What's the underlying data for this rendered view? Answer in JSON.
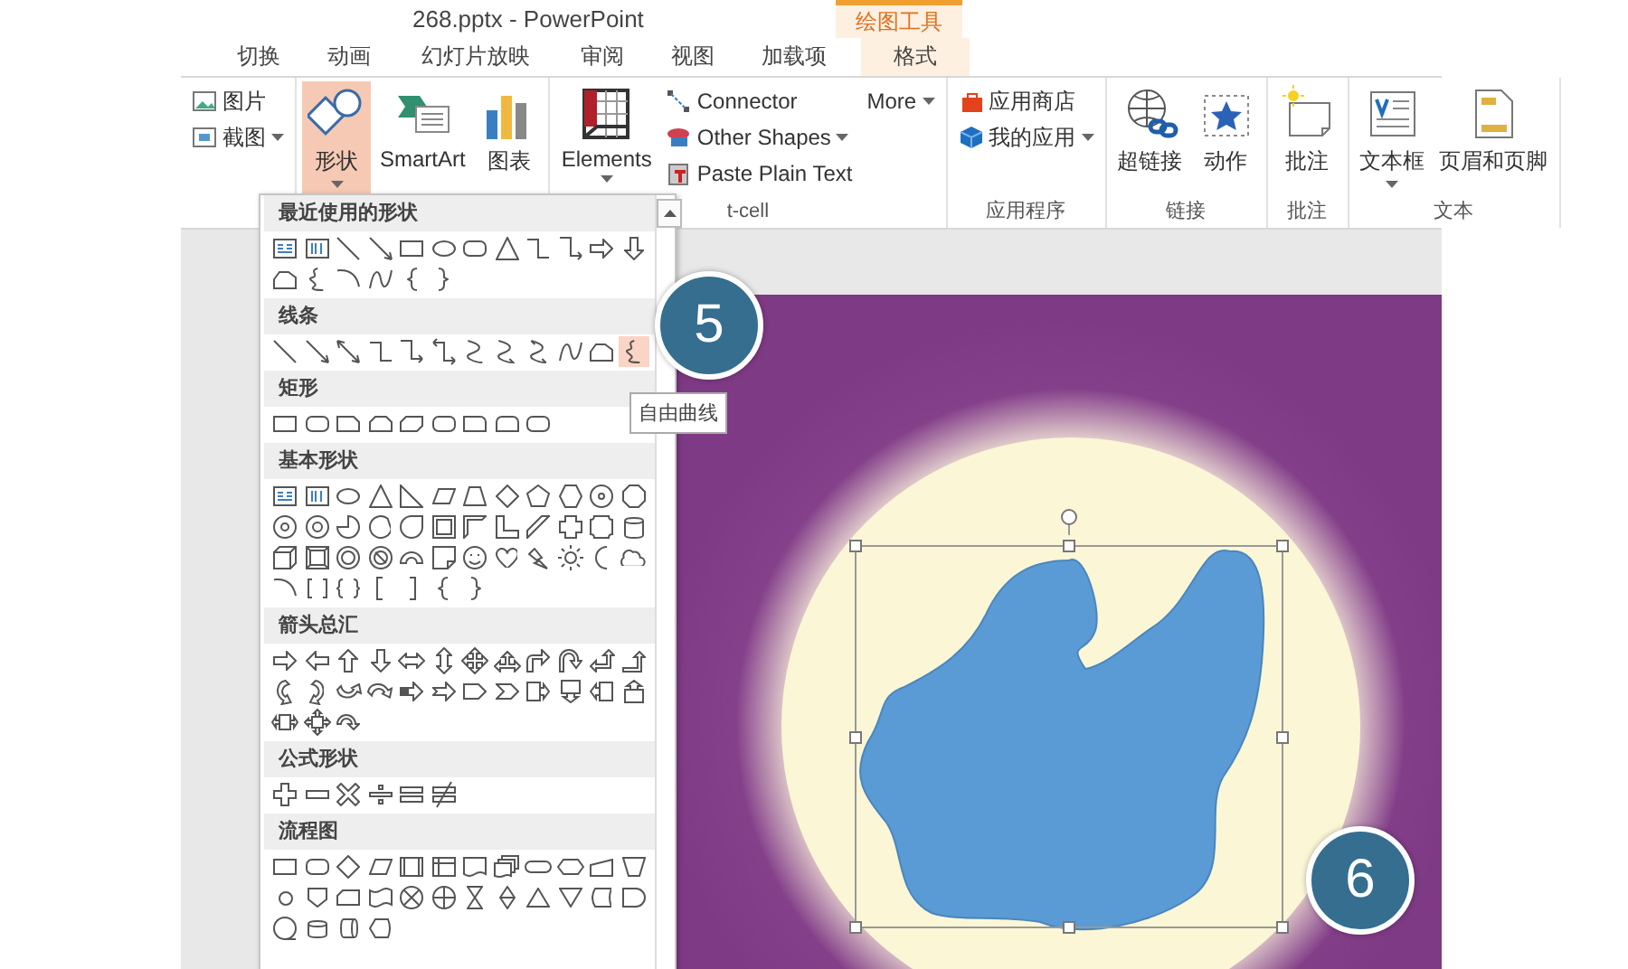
{
  "window": {
    "title": "268.pptx - PowerPoint",
    "context_tab": "绘图工具"
  },
  "tabs": [
    {
      "label": "切换",
      "selected": false
    },
    {
      "label": "动画",
      "selected": false
    },
    {
      "label": "幻灯片放映",
      "selected": false
    },
    {
      "label": "审阅",
      "selected": false
    },
    {
      "label": "视图",
      "selected": false
    },
    {
      "label": "加载项",
      "selected": false
    },
    {
      "label": "格式",
      "selected": true
    }
  ],
  "ribbon": {
    "groups": [
      {
        "columns": [
          {
            "kind": "small",
            "items": [
              {
                "kind": "picture",
                "label": "图片",
                "dropdown": false,
                "pressed": false
              },
              {
                "kind": "screenshot",
                "label": "截图",
                "dropdown": true,
                "pressed": false
              }
            ]
          }
        ]
      },
      {
        "columns": [
          {
            "kind": "large",
            "items": [
              {
                "kind": "shapes",
                "label": "形状",
                "dropdown": true,
                "pressed": true
              },
              {
                "kind": "smartart",
                "label": "SmartArt",
                "dropdown": false,
                "pressed": false
              },
              {
                "kind": "chart",
                "label": "图表",
                "dropdown": false,
                "pressed": false
              }
            ]
          }
        ]
      },
      {
        "label": "t-cell",
        "columns": [
          {
            "kind": "large",
            "items": [
              {
                "kind": "elements",
                "label": "Elements",
                "dropdown": true,
                "pressed": false
              }
            ]
          },
          {
            "kind": "small",
            "items": [
              {
                "kind": "connector",
                "label": "Connector",
                "dropdown": false,
                "pressed": false
              },
              {
                "kind": "other-shapes",
                "label": "Other Shapes",
                "dropdown": true,
                "pressed": false
              },
              {
                "kind": "paste",
                "label": "Paste Plain Text",
                "dropdown": false,
                "pressed": false
              }
            ]
          },
          {
            "kind": "small",
            "items": [
              {
                "kind": "none",
                "label": "More",
                "dropdown": true,
                "pressed": false
              }
            ]
          }
        ]
      },
      {
        "label": "应用程序",
        "columns": [
          {
            "kind": "small",
            "items": [
              {
                "kind": "store",
                "label": "应用商店",
                "dropdown": false,
                "pressed": false
              },
              {
                "kind": "myapps",
                "label": "我的应用",
                "dropdown": true,
                "pressed": false
              }
            ]
          }
        ]
      },
      {
        "label": "链接",
        "columns": [
          {
            "kind": "large",
            "items": [
              {
                "kind": "hyperlink",
                "label": "超链接",
                "dropdown": false,
                "pressed": false
              },
              {
                "kind": "action",
                "label": "动作",
                "dropdown": false,
                "pressed": false
              }
            ]
          }
        ]
      },
      {
        "label": "批注",
        "columns": [
          {
            "kind": "large",
            "items": [
              {
                "kind": "comment",
                "label": "批注",
                "dropdown": false,
                "pressed": false
              }
            ]
          }
        ]
      },
      {
        "label": "文本",
        "columns": [
          {
            "kind": "large",
            "items": [
              {
                "kind": "textbox",
                "label": "文本框",
                "dropdown": true,
                "pressed": false
              },
              {
                "kind": "header",
                "label": "页眉和页脚",
                "dropdown": false,
                "pressed": false
              }
            ]
          }
        ]
      }
    ]
  },
  "shape_gallery": {
    "sections": [
      {
        "title": "最近使用的形状",
        "shapes": [
          {
            "kind": "textbox",
            "selected": false
          },
          {
            "kind": "vtextbox",
            "selected": false
          },
          {
            "kind": "line",
            "selected": false
          },
          {
            "kind": "arrow-line",
            "selected": false
          },
          {
            "kind": "rect",
            "selected": false
          },
          {
            "kind": "oval",
            "selected": false
          },
          {
            "kind": "rrect",
            "selected": false
          },
          {
            "kind": "triangle",
            "selected": false
          },
          {
            "kind": "elbow",
            "selected": false
          },
          {
            "kind": "elbow-arrow",
            "selected": false
          },
          {
            "kind": "arrow-right",
            "selected": false
          },
          {
            "kind": "arrow-down",
            "selected": false
          },
          {
            "kind": "freeform",
            "selected": false
          },
          {
            "kind": "scribble",
            "selected": false
          },
          {
            "kind": "arc",
            "selected": false
          },
          {
            "kind": "curve",
            "selected": false
          },
          {
            "kind": "brace-left",
            "selected": false
          },
          {
            "kind": "brace-right",
            "selected": false
          }
        ]
      },
      {
        "title": "线条",
        "shapes": [
          {
            "kind": "line",
            "selected": false
          },
          {
            "kind": "arrow-line",
            "selected": false
          },
          {
            "kind": "double-arrow-line",
            "selected": false
          },
          {
            "kind": "elbow",
            "selected": false
          },
          {
            "kind": "elbow-arrow",
            "selected": false
          },
          {
            "kind": "elbow-double-arrow",
            "selected": false
          },
          {
            "kind": "s-curve",
            "selected": false
          },
          {
            "kind": "s-curve-arrow",
            "selected": false
          },
          {
            "kind": "s-curve-double-arrow",
            "selected": false
          },
          {
            "kind": "curve",
            "selected": false
          },
          {
            "kind": "freeform",
            "selected": false
          },
          {
            "kind": "scribble",
            "selected": true
          }
        ]
      },
      {
        "title": "矩形",
        "shapes": [
          {
            "kind": "rect",
            "selected": false
          },
          {
            "kind": "rrect",
            "selected": false
          },
          {
            "kind": "snip-rect",
            "selected": false
          },
          {
            "kind": "snip2-rect",
            "selected": false
          },
          {
            "kind": "snip-diag-rect",
            "selected": false
          },
          {
            "kind": "rrect",
            "selected": false
          },
          {
            "kind": "round-corner-rect",
            "selected": false
          },
          {
            "kind": "round2-rect",
            "selected": false
          },
          {
            "kind": "rrect",
            "selected": false
          }
        ]
      },
      {
        "title": "基本形状",
        "shapes": [
          {
            "kind": "textbox",
            "selected": false
          },
          {
            "kind": "vtextbox",
            "selected": false
          },
          {
            "kind": "oval",
            "selected": false
          },
          {
            "kind": "triangle",
            "selected": false
          },
          {
            "kind": "right-triangle",
            "selected": false
          },
          {
            "kind": "parallelogram",
            "selected": false
          },
          {
            "kind": "trapezoid",
            "selected": false
          },
          {
            "kind": "diamond",
            "selected": false
          },
          {
            "kind": "pentagon",
            "selected": false
          },
          {
            "kind": "hexagon",
            "selected": false
          },
          {
            "kind": "heptagon",
            "selected": false
          },
          {
            "kind": "octagon",
            "selected": false
          },
          {
            "kind": "decagon",
            "selected": false
          },
          {
            "kind": "dodecagon",
            "selected": false
          },
          {
            "kind": "pie",
            "selected": false
          },
          {
            "kind": "chord",
            "selected": false
          },
          {
            "kind": "teardrop",
            "selected": false
          },
          {
            "kind": "frame",
            "selected": false
          },
          {
            "kind": "half-frame",
            "selected": false
          },
          {
            "kind": "l-shape",
            "selected": false
          },
          {
            "kind": "diagonal-stripe",
            "selected": false
          },
          {
            "kind": "cross",
            "selected": false
          },
          {
            "kind": "plaque",
            "selected": false
          },
          {
            "kind": "cylinder",
            "selected": false
          },
          {
            "kind": "cube",
            "selected": false
          },
          {
            "kind": "bevel",
            "selected": false
          },
          {
            "kind": "donut",
            "selected": false
          },
          {
            "kind": "no-symbol",
            "selected": false
          },
          {
            "kind": "block-arc",
            "selected": false
          },
          {
            "kind": "folded-corner",
            "selected": false
          },
          {
            "kind": "smiley",
            "selected": false
          },
          {
            "kind": "heart",
            "selected": false
          },
          {
            "kind": "lightning",
            "selected": false
          },
          {
            "kind": "sun",
            "selected": false
          },
          {
            "kind": "moon",
            "selected": false
          },
          {
            "kind": "cloud",
            "selected": false
          },
          {
            "kind": "arc",
            "selected": false
          },
          {
            "kind": "bracket-pair",
            "selected": false
          },
          {
            "kind": "brace-pair",
            "selected": false
          },
          {
            "kind": "bracket-left",
            "selected": false
          },
          {
            "kind": "bracket-right",
            "selected": false
          },
          {
            "kind": "brace-left",
            "selected": false
          },
          {
            "kind": "brace-right",
            "selected": false
          }
        ]
      },
      {
        "title": "箭头总汇",
        "shapes": [
          {
            "kind": "arrow-right",
            "selected": false
          },
          {
            "kind": "arrow-left",
            "selected": false
          },
          {
            "kind": "arrow-up",
            "selected": false
          },
          {
            "kind": "arrow-down",
            "selected": false
          },
          {
            "kind": "arrow-left-right",
            "selected": false
          },
          {
            "kind": "arrow-up-down",
            "selected": false
          },
          {
            "kind": "arrow-quad",
            "selected": false
          },
          {
            "kind": "arrow-left-right-up",
            "selected": false
          },
          {
            "kind": "arrow-bent",
            "selected": false
          },
          {
            "kind": "arrow-uturn",
            "selected": false
          },
          {
            "kind": "arrow-left-up",
            "selected": false
          },
          {
            "kind": "arrow-bent-up",
            "selected": false
          },
          {
            "kind": "arrow-curved-right",
            "selected": false
          },
          {
            "kind": "arrow-curved-left",
            "selected": false
          },
          {
            "kind": "arrow-curved-up",
            "selected": false
          },
          {
            "kind": "arrow-curved-down",
            "selected": false
          },
          {
            "kind": "arrow-striped",
            "selected": false
          },
          {
            "kind": "arrow-notched",
            "selected": false
          },
          {
            "kind": "home-plate",
            "selected": false
          },
          {
            "kind": "chevron",
            "selected": false
          },
          {
            "kind": "callout-right",
            "selected": false
          },
          {
            "kind": "callout-down",
            "selected": false
          },
          {
            "kind": "callout-left",
            "selected": false
          },
          {
            "kind": "callout-up",
            "selected": false
          },
          {
            "kind": "callout-left-right",
            "selected": false
          },
          {
            "kind": "callout-quad",
            "selected": false
          },
          {
            "kind": "circular-arrow",
            "selected": false
          }
        ]
      },
      {
        "title": "公式形状",
        "shapes": [
          {
            "kind": "plus",
            "selected": false
          },
          {
            "kind": "minus",
            "selected": false
          },
          {
            "kind": "multiply",
            "selected": false
          },
          {
            "kind": "divide",
            "selected": false
          },
          {
            "kind": "equal",
            "selected": false
          },
          {
            "kind": "not-equal",
            "selected": false
          }
        ]
      },
      {
        "title": "流程图",
        "shapes": [
          {
            "kind": "rect",
            "selected": false
          },
          {
            "kind": "rrect",
            "selected": false
          },
          {
            "kind": "diamond",
            "selected": false
          },
          {
            "kind": "parallelogram",
            "selected": false
          },
          {
            "kind": "predefined",
            "selected": false
          },
          {
            "kind": "internal-storage",
            "selected": false
          },
          {
            "kind": "document",
            "selected": false
          },
          {
            "kind": "multidocument",
            "selected": false
          },
          {
            "kind": "terminator",
            "selected": false
          },
          {
            "kind": "hexagon-flat",
            "selected": false
          },
          {
            "kind": "manual-input",
            "selected": false
          },
          {
            "kind": "manual-operation",
            "selected": false
          },
          {
            "kind": "small-circle",
            "selected": false
          },
          {
            "kind": "off-page",
            "selected": false
          },
          {
            "kind": "card",
            "selected": false
          },
          {
            "kind": "punched-tape",
            "selected": false
          },
          {
            "kind": "summing-junction",
            "selected": false
          },
          {
            "kind": "or",
            "selected": false
          },
          {
            "kind": "collate",
            "selected": false
          },
          {
            "kind": "sort",
            "selected": false
          },
          {
            "kind": "extract",
            "selected": false
          },
          {
            "kind": "merge",
            "selected": false
          },
          {
            "kind": "stored-data",
            "selected": false
          },
          {
            "kind": "delay",
            "selected": false
          },
          {
            "kind": "sequential-access",
            "selected": false
          },
          {
            "kind": "magnetic-disk",
            "selected": false
          },
          {
            "kind": "direct-access",
            "selected": false
          },
          {
            "kind": "display",
            "selected": false
          }
        ]
      }
    ],
    "tooltip": "自由曲线"
  },
  "slide": {
    "shape": {
      "selected": true
    }
  },
  "callouts": [
    {
      "label": "5"
    },
    {
      "label": "6"
    }
  ]
}
